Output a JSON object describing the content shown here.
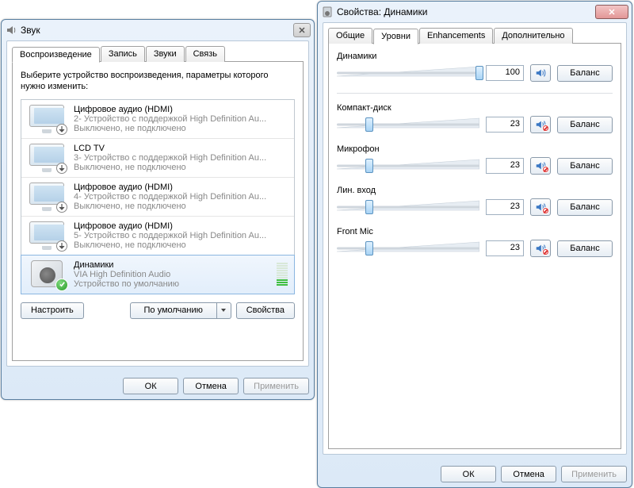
{
  "win1": {
    "title": "Звук",
    "tabs": [
      "Воспроизведение",
      "Запись",
      "Звуки",
      "Связь"
    ],
    "activeTab": 0,
    "instruction": "Выберите устройство воспроизведения, параметры которого нужно изменить:",
    "devices": [
      {
        "name": "Цифровое аудио (HDMI)",
        "sub": "2- Устройство с поддержкой High Definition Au...",
        "status": "Выключено, не подключено",
        "icon": "monitor",
        "badge": "down"
      },
      {
        "name": "LCD TV",
        "sub": "3- Устройство с поддержкой High Definition Au...",
        "status": "Выключено, не подключено",
        "icon": "monitor",
        "badge": "down"
      },
      {
        "name": "Цифровое аудио (HDMI)",
        "sub": "4- Устройство с поддержкой High Definition Au...",
        "status": "Выключено, не подключено",
        "icon": "monitor",
        "badge": "down"
      },
      {
        "name": "Цифровое аудио (HDMI)",
        "sub": "5- Устройство с поддержкой High Definition Au...",
        "status": "Выключено, не подключено",
        "icon": "monitor",
        "badge": "down"
      },
      {
        "name": "Динамики",
        "sub": "VIA High Definition Audio",
        "status": "Устройство по умолчанию",
        "icon": "speaker",
        "badge": "check",
        "selected": true,
        "level": true
      }
    ],
    "btnConfigure": "Настроить",
    "btnDefault": "По умолчанию",
    "btnProps": "Свойства",
    "btnOK": "ОК",
    "btnCancel": "Отмена",
    "btnApply": "Применить"
  },
  "win2": {
    "title": "Свойства: Динамики",
    "tabs": [
      "Общие",
      "Уровни",
      "Enhancements",
      "Дополнительно"
    ],
    "activeTab": 1,
    "levels": [
      {
        "label": "Динамики",
        "value": 100,
        "muted": false
      },
      {
        "label": "Компакт-диск",
        "value": 23,
        "muted": true
      },
      {
        "label": "Микрофон",
        "value": 23,
        "muted": true
      },
      {
        "label": "Лин. вход",
        "value": 23,
        "muted": true
      },
      {
        "label": "Front Mic",
        "value": 23,
        "muted": true
      }
    ],
    "btnBalance": "Баланс",
    "btnOK": "ОК",
    "btnCancel": "Отмена",
    "btnApply": "Применить"
  }
}
